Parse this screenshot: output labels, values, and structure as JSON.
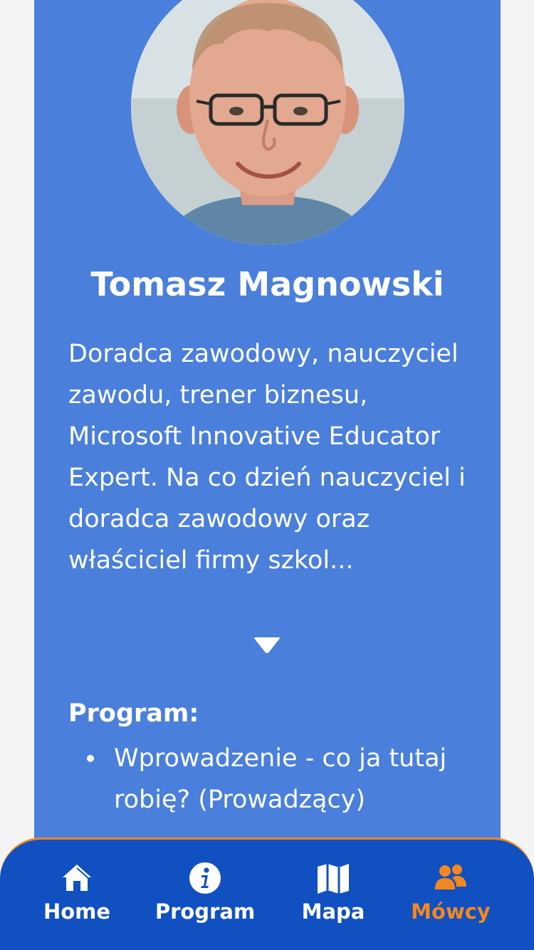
{
  "speaker": {
    "name": "Tomasz Magnowski",
    "bio": "Doradca zawodowy, nauczyciel zawodu, trener biznesu, Microsoft Innovative Educator Expert. Na co dzień nauczyciel i doradca zawodowy oraz właściciel firmy szkol...",
    "expand_icon": "chevron-down-triangle"
  },
  "program": {
    "heading": "Program:",
    "items": [
      {
        "label": "Wprowadzenie - co ja tutaj robię? (Prowadzący)"
      }
    ]
  },
  "bottom_nav": {
    "items": [
      {
        "label": "Home",
        "icon": "home-icon",
        "active": false
      },
      {
        "label": "Program",
        "icon": "info-icon",
        "active": false
      },
      {
        "label": "Mapa",
        "icon": "map-icon",
        "active": false
      },
      {
        "label": "Mówcy",
        "icon": "people-icon",
        "active": true
      }
    ]
  },
  "colors": {
    "card_background": "#4a7fdb",
    "nav_background": "#1050c0",
    "active_accent": "#f5871f",
    "page_background": "#f4f4f4",
    "text": "#ffffff"
  }
}
